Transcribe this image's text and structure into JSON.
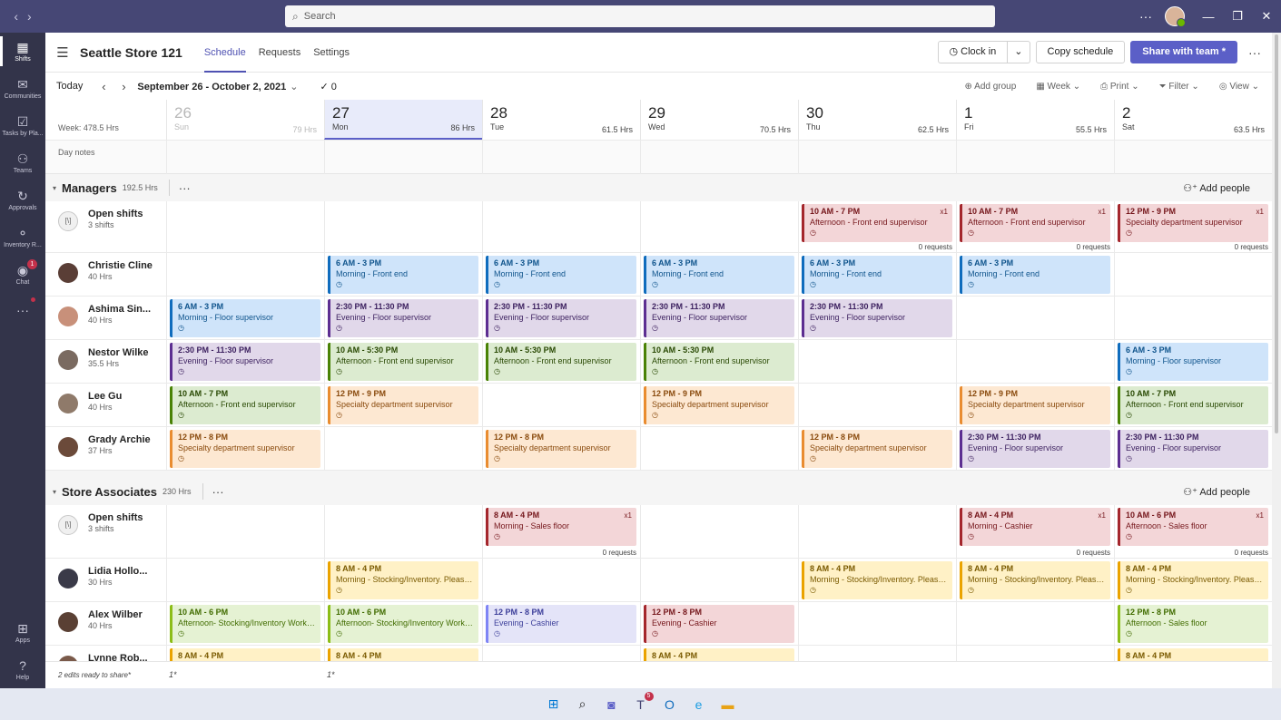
{
  "titlebar": {
    "search_placeholder": "Search"
  },
  "rail": [
    {
      "name": "shifts",
      "label": "Shifts",
      "icon": "shifts-icon",
      "glyph": "▦",
      "active": true
    },
    {
      "name": "communities",
      "label": "Communities",
      "icon": "communities-icon",
      "glyph": "✉"
    },
    {
      "name": "tasks",
      "label": "Tasks by Pla...",
      "icon": "tasks-icon",
      "glyph": "☑"
    },
    {
      "name": "teams",
      "label": "Teams",
      "icon": "teams-icon",
      "glyph": "⚇"
    },
    {
      "name": "approvals",
      "label": "Approvals",
      "icon": "approvals-icon",
      "glyph": "↻"
    },
    {
      "name": "inventory",
      "label": "Inventory R...",
      "icon": "inventory-icon",
      "glyph": "⚬"
    },
    {
      "name": "chat",
      "label": "Chat",
      "icon": "chat-icon",
      "glyph": "◉",
      "badge": "1"
    },
    {
      "name": "more",
      "label": "",
      "icon": "more-apps-icon",
      "glyph": "···"
    }
  ],
  "rail_bottom": [
    {
      "name": "apps",
      "label": "Apps",
      "icon": "apps-icon",
      "glyph": "⊞"
    },
    {
      "name": "help",
      "label": "Help",
      "icon": "help-icon",
      "glyph": "?"
    }
  ],
  "header": {
    "store": "Seattle Store 121",
    "tabs": [
      "Schedule",
      "Requests",
      "Settings"
    ],
    "clock_in": "Clock in",
    "copy": "Copy schedule",
    "share": "Share with team *"
  },
  "toolbar": {
    "today": "Today",
    "range": "September 26 - October 2, 2021",
    "check_count": "0",
    "add_group": "Add group",
    "week": "Week",
    "print": "Print",
    "filter": "Filter",
    "view": "View"
  },
  "week_total": "Week: 478.5 Hrs",
  "day_notes_label": "Day notes",
  "days": [
    {
      "num": "26",
      "name": "Sun",
      "hrs": "79 Hrs",
      "past": true
    },
    {
      "num": "27",
      "name": "Mon",
      "hrs": "86 Hrs",
      "today": true
    },
    {
      "num": "28",
      "name": "Tue",
      "hrs": "61.5 Hrs"
    },
    {
      "num": "29",
      "name": "Wed",
      "hrs": "70.5 Hrs"
    },
    {
      "num": "30",
      "name": "Thu",
      "hrs": "62.5 Hrs"
    },
    {
      "num": "1",
      "name": "Fri",
      "hrs": "55.5 Hrs"
    },
    {
      "num": "2",
      "name": "Sat",
      "hrs": "63.5 Hrs"
    }
  ],
  "groups": [
    {
      "name": "Managers",
      "hrs": "192.5 Hrs",
      "add_people": "Add people",
      "rows": [
        {
          "name": "Open shifts",
          "sub": "3 shifts",
          "open": true,
          "shifts": [
            null,
            null,
            null,
            null,
            {
              "time": "10 AM - 7 PM",
              "desc": "Afternoon - Front end supervisor",
              "color": "red",
              "x1": "x1",
              "reqs": "0 requests"
            },
            {
              "time": "10 AM - 7 PM",
              "desc": "Afternoon - Front end supervisor",
              "color": "red",
              "x1": "x1",
              "reqs": "0 requests"
            },
            {
              "time": "12 PM - 9 PM",
              "desc": "Specialty department supervisor",
              "color": "red",
              "x1": "x1",
              "reqs": "0 requests"
            }
          ]
        },
        {
          "name": "Christie Cline",
          "sub": "40 Hrs",
          "avatar": "#5a3e36",
          "shifts": [
            null,
            {
              "time": "6 AM - 3 PM",
              "desc": "Morning - Front end",
              "color": "blue"
            },
            {
              "time": "6 AM - 3 PM",
              "desc": "Morning - Front end",
              "color": "blue"
            },
            {
              "time": "6 AM - 3 PM",
              "desc": "Morning - Front end",
              "color": "blue"
            },
            {
              "time": "6 AM - 3 PM",
              "desc": "Morning - Front end",
              "color": "blue"
            },
            {
              "time": "6 AM - 3 PM",
              "desc": "Morning - Front end",
              "color": "blue"
            },
            null
          ]
        },
        {
          "name": "Ashima Sin...",
          "sub": "40 Hrs",
          "avatar": "#c8907a",
          "shifts": [
            {
              "time": "6 AM - 3 PM",
              "desc": "Morning - Floor supervisor",
              "color": "blue"
            },
            {
              "time": "2:30 PM - 11:30 PM",
              "desc": "Evening - Floor supervisor",
              "color": "purple"
            },
            {
              "time": "2:30 PM - 11:30 PM",
              "desc": "Evening - Floor supervisor",
              "color": "purple"
            },
            {
              "time": "2:30 PM - 11:30 PM",
              "desc": "Evening - Floor supervisor",
              "color": "purple"
            },
            {
              "time": "2:30 PM - 11:30 PM",
              "desc": "Evening - Floor supervisor",
              "color": "purple"
            },
            null,
            null
          ]
        },
        {
          "name": "Nestor Wilke",
          "sub": "35.5 Hrs",
          "avatar": "#7a6a60",
          "shifts": [
            {
              "time": "2:30 PM - 11:30 PM",
              "desc": "Evening - Floor supervisor",
              "color": "purple"
            },
            {
              "time": "10 AM - 5:30 PM",
              "desc": "Afternoon - Front end supervisor",
              "color": "green"
            },
            {
              "time": "10 AM - 5:30 PM",
              "desc": "Afternoon - Front end supervisor",
              "color": "green"
            },
            {
              "time": "10 AM - 5:30 PM",
              "desc": "Afternoon - Front end supervisor",
              "color": "green"
            },
            null,
            null,
            {
              "time": "6 AM - 3 PM",
              "desc": "Morning - Floor supervisor",
              "color": "blue"
            }
          ]
        },
        {
          "name": "Lee Gu",
          "sub": "40 Hrs",
          "avatar": "#8f7a6a",
          "shifts": [
            {
              "time": "10 AM - 7 PM",
              "desc": "Afternoon - Front end supervisor",
              "color": "green"
            },
            {
              "time": "12 PM - 9 PM",
              "desc": "Specialty department supervisor",
              "color": "orange"
            },
            null,
            {
              "time": "12 PM - 9 PM",
              "desc": "Specialty department supervisor",
              "color": "orange"
            },
            null,
            {
              "time": "12 PM - 9 PM",
              "desc": "Specialty department supervisor",
              "color": "orange"
            },
            {
              "time": "10 AM - 7 PM",
              "desc": "Afternoon - Front end supervisor",
              "color": "green"
            }
          ]
        },
        {
          "name": "Grady Archie",
          "sub": "37 Hrs",
          "avatar": "#6b4a3a",
          "shifts": [
            {
              "time": "12 PM - 8 PM",
              "desc": "Specialty department supervisor",
              "color": "orange"
            },
            null,
            {
              "time": "12 PM - 8 PM",
              "desc": "Specialty department supervisor",
              "color": "orange"
            },
            null,
            {
              "time": "12 PM - 8 PM",
              "desc": "Specialty department supervisor",
              "color": "orange"
            },
            {
              "time": "2:30 PM - 11:30 PM",
              "desc": "Evening - Floor supervisor",
              "color": "purple"
            },
            {
              "time": "2:30 PM - 11:30 PM",
              "desc": "Evening - Floor supervisor",
              "color": "purple"
            }
          ]
        }
      ]
    },
    {
      "name": "Store Associates",
      "hrs": "230 Hrs",
      "add_people": "Add people",
      "rows": [
        {
          "name": "Open shifts",
          "sub": "3 shifts",
          "open": true,
          "shifts": [
            null,
            null,
            {
              "time": "8 AM - 4 PM",
              "desc": "Morning - Sales floor",
              "color": "red",
              "x1": "x1",
              "reqs": "0 requests"
            },
            null,
            null,
            {
              "time": "8 AM - 4 PM",
              "desc": "Morning - Cashier",
              "color": "red",
              "x1": "x1",
              "reqs": "0 requests"
            },
            {
              "time": "10 AM - 6 PM",
              "desc": "Afternoon - Sales floor",
              "color": "red",
              "x1": "x1",
              "reqs": "0 requests"
            }
          ]
        },
        {
          "name": "Lidia Hollo...",
          "sub": "30 Hrs",
          "avatar": "#3a3a48",
          "shifts": [
            null,
            {
              "time": "8 AM - 4 PM",
              "desc": "Morning - Stocking/Inventory. Please ...",
              "color": "yellow"
            },
            null,
            null,
            {
              "time": "8 AM - 4 PM",
              "desc": "Morning - Stocking/Inventory. Please ...",
              "color": "yellow"
            },
            {
              "time": "8 AM - 4 PM",
              "desc": "Morning - Stocking/Inventory. Please ...",
              "color": "yellow"
            },
            {
              "time": "8 AM - 4 PM",
              "desc": "Morning - Stocking/Inventory. Please ...",
              "color": "yellow"
            }
          ]
        },
        {
          "name": "Alex Wilber",
          "sub": "40 Hrs",
          "avatar": "#5a4034",
          "shifts": [
            {
              "time": "10 AM - 6 PM",
              "desc": "Afternoon- Stocking/Inventory Work ...",
              "color": "lime"
            },
            {
              "time": "10 AM - 6 PM",
              "desc": "Afternoon- Stocking/Inventory Work ...",
              "color": "lime"
            },
            {
              "time": "12 PM - 8 PM",
              "desc": "Evening - Cashier",
              "color": "lavender"
            },
            {
              "time": "12 PM - 8 PM",
              "desc": "Evening - Cashier",
              "color": "red"
            },
            null,
            null,
            {
              "time": "12 PM - 8 PM",
              "desc": "Afternoon - Sales floor",
              "color": "lime"
            }
          ]
        },
        {
          "name": "Lynne Rob...",
          "sub": "",
          "avatar": "#7a5a4a",
          "shifts": [
            {
              "time": "8 AM - 4 PM",
              "desc": "",
              "color": "yellow"
            },
            {
              "time": "8 AM - 4 PM",
              "desc": "",
              "color": "yellow"
            },
            null,
            {
              "time": "8 AM - 4 PM",
              "desc": "",
              "color": "yellow"
            },
            null,
            null,
            {
              "time": "8 AM - 4 PM",
              "desc": "",
              "color": "yellow"
            }
          ]
        }
      ]
    }
  ],
  "footer": {
    "edits": "2 edits ready to share*",
    "counts": [
      "1*",
      "1*"
    ]
  },
  "taskbar": [
    {
      "name": "start",
      "icon": "windows-start-icon",
      "glyph": "⊞",
      "color": "#0078d4"
    },
    {
      "name": "search",
      "icon": "search-icon",
      "glyph": "⌕",
      "color": "#202020"
    },
    {
      "name": "meet",
      "icon": "video-chat-icon",
      "glyph": "◙",
      "color": "#5b5fc7"
    },
    {
      "name": "teams",
      "icon": "teams-icon",
      "glyph": "T",
      "color": "#464775",
      "badge": "5"
    },
    {
      "name": "outlook",
      "icon": "outlook-icon",
      "glyph": "O",
      "color": "#0f6cbd"
    },
    {
      "name": "edge",
      "icon": "edge-icon",
      "glyph": "e",
      "color": "#1b9de2"
    },
    {
      "name": "explorer",
      "icon": "folder-icon",
      "glyph": "▬",
      "color": "#e8a317"
    }
  ]
}
